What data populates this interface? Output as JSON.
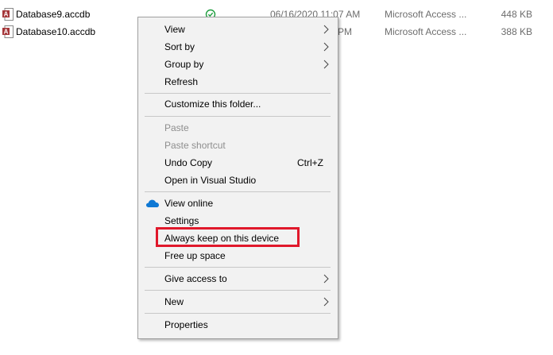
{
  "files": [
    {
      "name": "Database9.accdb",
      "status": "synced",
      "date": "06/16/2020 11:07 AM",
      "type": "Microsoft Access ...",
      "size": "448 KB"
    },
    {
      "name": "Database10.accdb",
      "status": "",
      "date": "PM",
      "type": "Microsoft Access ...",
      "size": "388 KB"
    }
  ],
  "menu": {
    "view": "View",
    "sort_by": "Sort by",
    "group_by": "Group by",
    "refresh": "Refresh",
    "customize": "Customize this folder...",
    "paste": "Paste",
    "paste_shortcut": "Paste shortcut",
    "undo_copy": "Undo Copy",
    "undo_shortcut": "Ctrl+Z",
    "open_vs": "Open in Visual Studio",
    "view_online": "View online",
    "settings": "Settings",
    "always_keep": "Always keep on this device",
    "free_up": "Free up space",
    "give_access": "Give access to",
    "new": "New",
    "properties": "Properties"
  },
  "colors": {
    "highlight": "#e0182b",
    "onedrive": "#0f78d4",
    "sync_green": "#1f9e3f",
    "access_red": "#a4373a"
  }
}
